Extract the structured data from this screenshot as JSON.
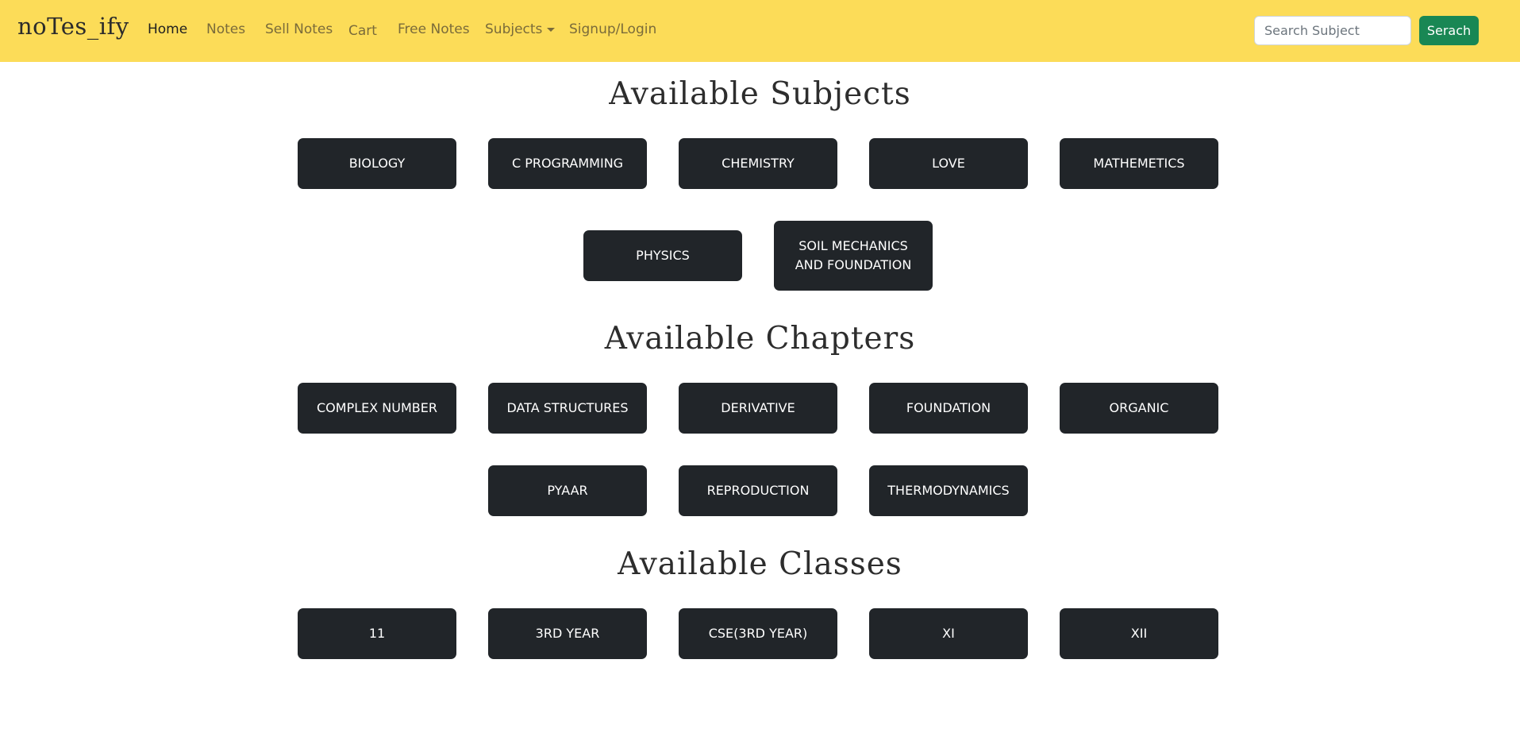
{
  "navbar": {
    "brand": "noTes_ify",
    "items": [
      {
        "label": "Home",
        "active": true
      },
      {
        "label": "Notes"
      },
      {
        "label": "Sell Notes"
      },
      {
        "label": "Cart"
      },
      {
        "label": "Free Notes"
      },
      {
        "label": "Subjects",
        "dropdown": true
      },
      {
        "label": "Signup/Login"
      }
    ],
    "search": {
      "placeholder": "Search Subject",
      "value": "",
      "button_label": "Serach"
    }
  },
  "subjects": {
    "title": "Available Subjects",
    "items": [
      "BIOLOGY",
      "C PROGRAMMING",
      "CHEMISTRY",
      "LOVE",
      "MATHEMETICS",
      "PHYSICS",
      "SOIL MECHANICS AND FOUNDATION"
    ]
  },
  "chapters": {
    "title": "Available Chapters",
    "items": [
      "COMPLEX NUMBER",
      "DATA STRUCTURES",
      "DERIVATIVE",
      "FOUNDATION",
      "ORGANIC",
      "PYAAR",
      "REPRODUCTION",
      "THERMODYNAMICS"
    ]
  },
  "classes": {
    "title": "Available Classes",
    "items": [
      "11",
      "3RD YEAR",
      "CSE(3RD YEAR)",
      "XI",
      "XII"
    ]
  },
  "colors": {
    "navbar_bg": "#fcdc58",
    "tile_bg": "#212529",
    "search_button_bg": "#198754"
  }
}
